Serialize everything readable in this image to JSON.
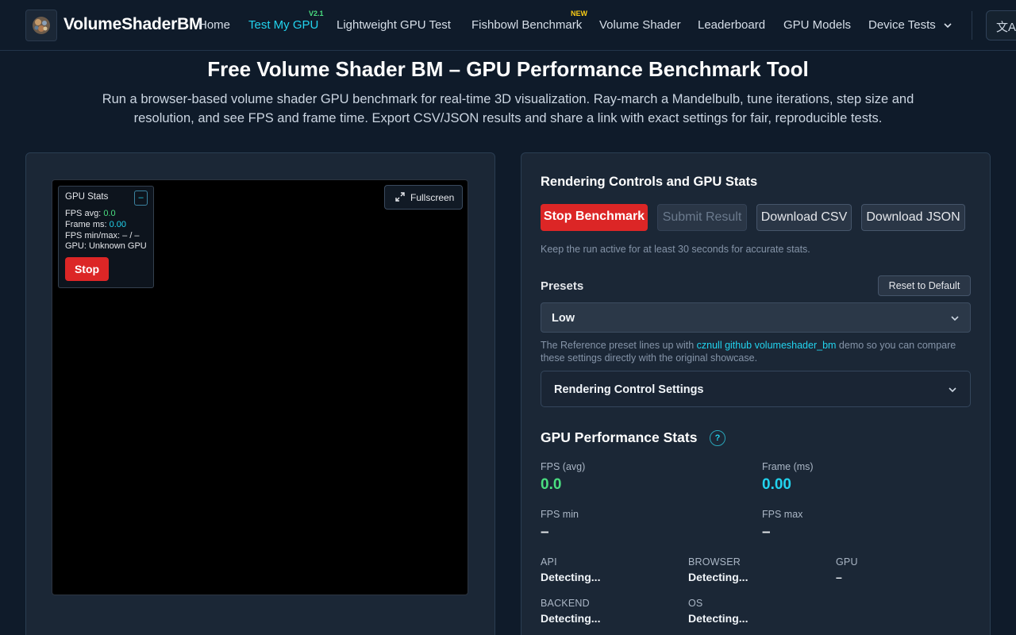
{
  "nav": {
    "brand": "VolumeShaderBM",
    "items": [
      {
        "label": "Home"
      },
      {
        "label": "Test My GPU",
        "badge": "V2.1"
      },
      {
        "label": "Lightweight GPU Test"
      },
      {
        "label": "Fishbowl Benchmark",
        "badge": "NEW"
      },
      {
        "label": "Volume Shader"
      },
      {
        "label": "Leaderboard"
      },
      {
        "label": "GPU Models"
      },
      {
        "label": "Device Tests"
      }
    ],
    "active_color": "#22d3ee",
    "badge_colors": {
      "version": "#4ade80",
      "new": "#facc15"
    },
    "language_icon": "translate-icon"
  },
  "hero": {
    "title": "Free Volume Shader BM – GPU Performance Benchmark Tool",
    "subtitle": "Run a browser-based volume shader GPU benchmark for real-time 3D visualization. Ray-march a Mandelbulb, tune iterations, step size and resolution, and see FPS and frame time. Export CSV/JSON results and share a link with exact settings for fair, reproducible tests."
  },
  "overlay": {
    "title": "GPU Stats",
    "minimize_label": "–",
    "fps_avg_label": "FPS avg:",
    "fps_avg": "0.0",
    "frame_ms_label": "Frame ms:",
    "frame_ms": "0.00",
    "fps_minmax_label": "FPS min/max:",
    "fps_minmax": "– / –",
    "gpu_label": "GPU:",
    "gpu": "Unknown GPU",
    "stop_label": "Stop",
    "fullscreen_label": "Fullscreen"
  },
  "controls": {
    "title": "Rendering Controls and GPU Stats",
    "stop_label": "Stop Benchmark",
    "submit_label": "Submit Result",
    "csv_label": "Download CSV",
    "json_label": "Download JSON",
    "hint": "Keep the run active for at least 30 seconds for accurate stats.",
    "presets_label": "Presets",
    "reset_label": "Reset to Default",
    "preset_value": "Low",
    "ref_note_pre": "The Reference preset lines up with ",
    "ref_note_link": "cznull github volumeshader_bm",
    "ref_note_post": " demo so you can compare these settings directly with the original showcase.",
    "collapse_label": "Rendering Control Settings"
  },
  "perf": {
    "title": "GPU Performance Stats",
    "help": "?",
    "fps_avg_label": "FPS (avg)",
    "fps_avg": "0.0",
    "frame_label": "Frame (ms)",
    "frame": "0.00",
    "fps_min_label": "FPS min",
    "fps_min": "–",
    "fps_max_label": "FPS max",
    "fps_max": "–",
    "api_label": "API",
    "api": "Detecting...",
    "browser_label": "BROWSER",
    "browser": "Detecting...",
    "gpu_label": "GPU",
    "gpu": "–",
    "backend_label": "BACKEND",
    "backend": "Detecting...",
    "os_label": "OS",
    "os": "Detecting..."
  },
  "colors": {
    "background": "#0f1b2a",
    "panel": "#1b2736",
    "accent": "#22d3ee",
    "danger": "#dc2626",
    "good": "#4ade80"
  }
}
